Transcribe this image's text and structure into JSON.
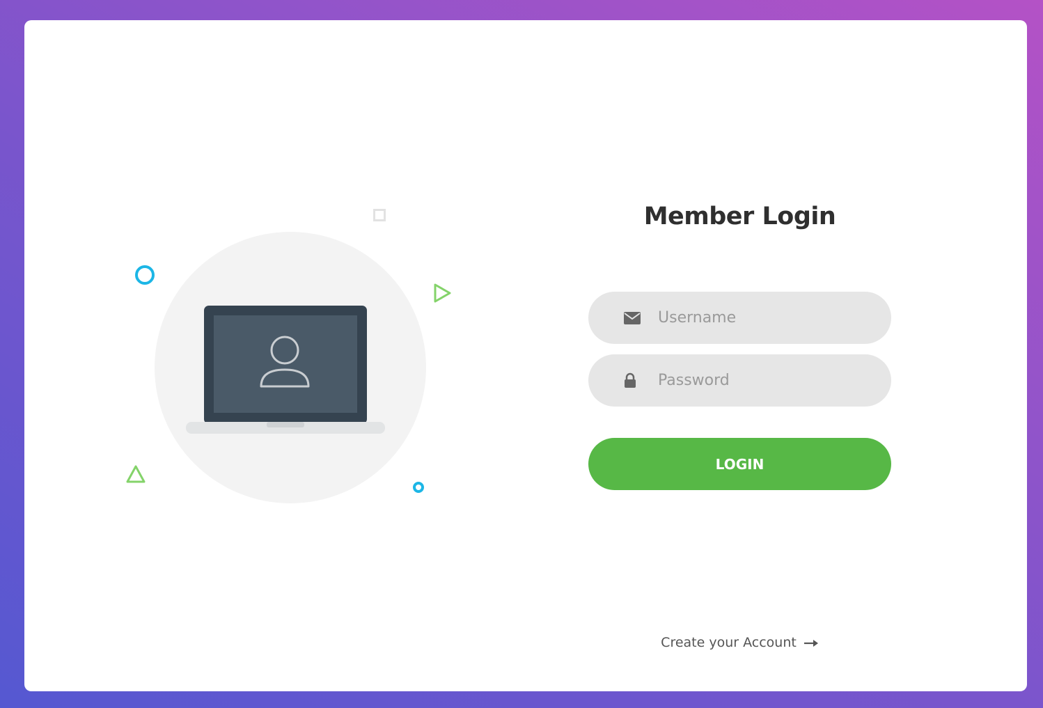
{
  "login": {
    "title": "Member Login",
    "username_placeholder": "Username",
    "password_placeholder": "Password",
    "login_label": "LOGIN",
    "create_account_label": "Create your Account"
  },
  "icons": {
    "username": "envelope-icon",
    "password": "lock-icon",
    "create_account": "arrow-right-icon",
    "illustration": "laptop-user-icon"
  },
  "colors": {
    "login_button": "#57b846",
    "field_background": "#e6e6e6",
    "accent_blue": "#1cb6e6",
    "accent_green": "#84d36a"
  }
}
